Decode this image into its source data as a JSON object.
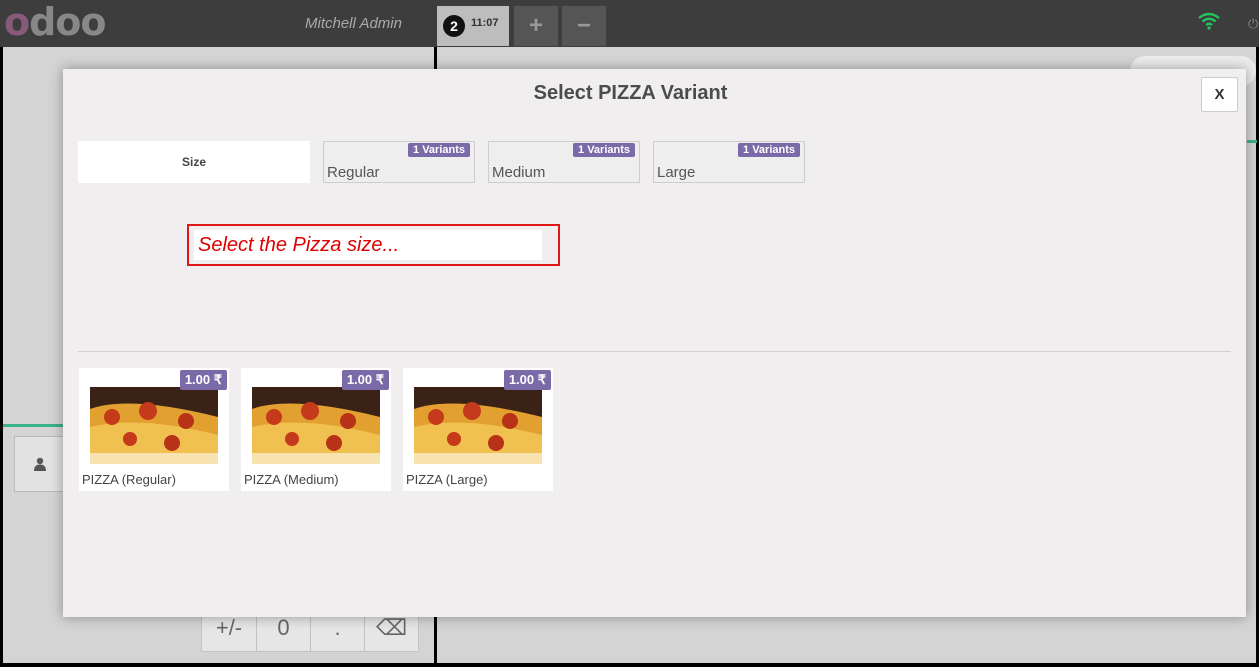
{
  "topbar": {
    "logo": "odoo",
    "user": "Mitchell Admin",
    "order_number": "2",
    "order_time": "11:07",
    "add_label": "+",
    "remove_label": "−"
  },
  "colors": {
    "badge": "#7a6aa8",
    "hint_border": "#e01818",
    "hint_text": "#dd0000",
    "wifi": "#22c55e",
    "accent_green": "#3bb18d"
  },
  "numpad": [
    "+/-",
    "0",
    ".",
    "⌫"
  ],
  "modal": {
    "title": "Select PIZZA Variant",
    "close_label": "X",
    "attribute": {
      "name": "Size",
      "values": [
        {
          "label": "Regular",
          "badge": "1 Variants"
        },
        {
          "label": "Medium",
          "badge": "1 Variants"
        },
        {
          "label": "Large",
          "badge": "1 Variants"
        }
      ]
    },
    "hint": "Select the Pizza size...",
    "products": [
      {
        "name": "PIZZA (Regular)",
        "price": "1.00 ₹"
      },
      {
        "name": "PIZZA (Medium)",
        "price": "1.00 ₹"
      },
      {
        "name": "PIZZA (Large)",
        "price": "1.00 ₹"
      }
    ]
  }
}
